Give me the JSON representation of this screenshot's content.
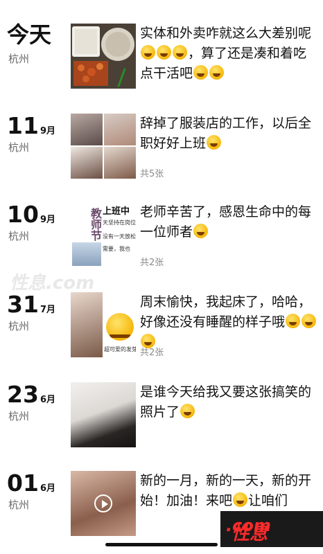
{
  "posts": [
    {
      "day": "今天",
      "month": "",
      "location": "杭州",
      "text": "实体和外卖咋就这么大差别呢",
      "text2": "，算了还是凑和着吃点干活吧",
      "photo_count": ""
    },
    {
      "day": "11",
      "month": "9月",
      "location": "杭州",
      "text": "辞掉了服装店的工作，以后全职好好上班",
      "photo_count": "共5张"
    },
    {
      "day": "10",
      "month": "9月",
      "location": "杭州",
      "text": "老师辛苦了，感恩生命中的每一位师者",
      "photo_count": "共2张",
      "poster": {
        "title": "上班中",
        "line1": "天坚持在岗位",
        "line2": "没有一天放松",
        "line3": "需要，我也",
        "calligraphy": "教师节"
      }
    },
    {
      "day": "31",
      "month": "7月",
      "location": "杭州",
      "text": "周末愉快，我起床了，哈哈，好像还没有睡醒的样子哦",
      "photo_count": "共2张",
      "sticker_caption": "超可爱的发芽"
    },
    {
      "day": "23",
      "month": "6月",
      "location": "杭州",
      "text": "是谁今天给我又要这张搞笑的照片了",
      "photo_count": ""
    },
    {
      "day": "01",
      "month": "6月",
      "location": "杭州",
      "text": "新的一月，新的一天，新的开始！加油！来吧",
      "text_tail": "让咱们",
      "photo_count": ""
    }
  ],
  "watermark": {
    "brand": "性息",
    "suffix": ".com",
    "faint": "性息.com"
  },
  "colors": {
    "text": "#111111",
    "location": "#6a6a6a",
    "count": "#8a8a8a",
    "watermark": "#ff2a2a"
  }
}
